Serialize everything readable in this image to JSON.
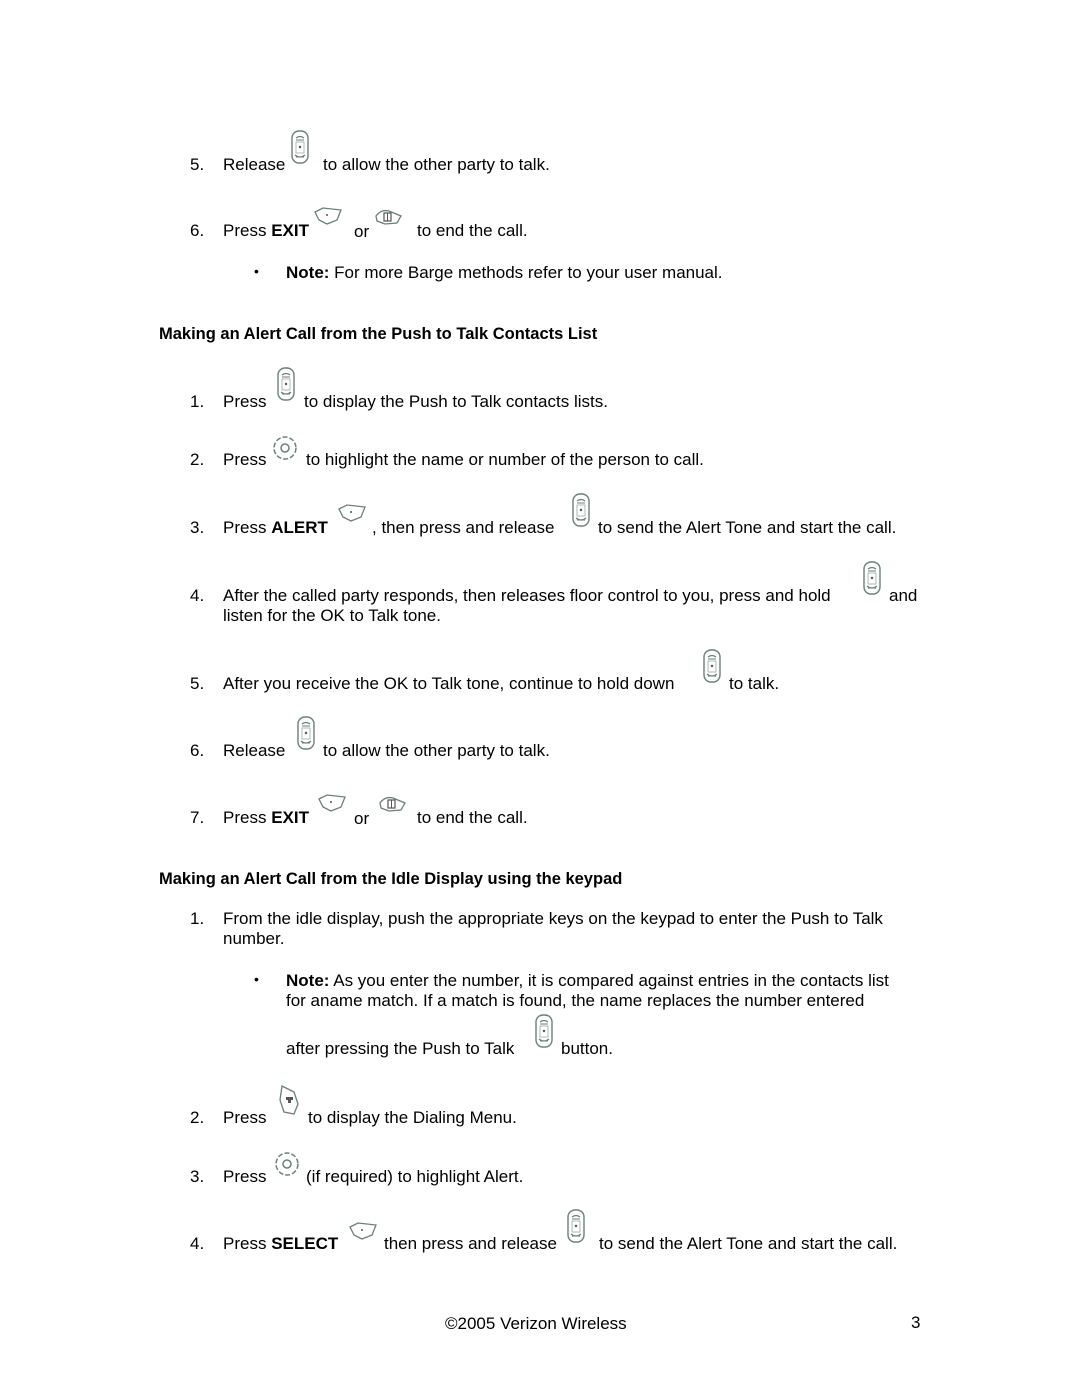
{
  "section1": {
    "steps": [
      {
        "num": "5.",
        "parts": [
          "Release",
          "to allow the other party to talk."
        ],
        "icons": [
          "ptt-button-icon"
        ]
      },
      {
        "num": "6.",
        "pre": "Press ",
        "bold": "EXIT",
        "or": "or",
        "post": "to end the call.",
        "icons": [
          "left-softkey-icon",
          "end-key-icon"
        ]
      }
    ],
    "note": {
      "label": "Note:",
      "text": " For more Barge methods refer to your user manual."
    }
  },
  "section2": {
    "heading": "Making an Alert Call from the Push to Talk Contacts List",
    "steps": [
      {
        "num": "1.",
        "pre": "Press",
        "post": "to display the Push to Talk contacts lists.",
        "icon": "ptt-button-icon"
      },
      {
        "num": "2.",
        "pre": "Press",
        "post": "to highlight the name or number of the person to call.",
        "icon": "nav-key-icon"
      },
      {
        "num": "3.",
        "pre": "Press ",
        "bold": "ALERT",
        "mid": ", then press and release",
        "post": "to send the Alert Tone and start the call.",
        "icons": [
          "left-softkey-icon",
          "ptt-button-icon"
        ]
      },
      {
        "num": "4.",
        "line1": "After the called party responds, then releases floor control to you, press and hold",
        "line1_end": "and",
        "line2": "listen for the OK to Talk tone.",
        "icon": "ptt-button-icon"
      },
      {
        "num": "5.",
        "pre": "After you receive the OK to Talk tone, continue to hold down",
        "post": "to talk.",
        "icon": "ptt-button-icon"
      },
      {
        "num": "6.",
        "pre": "Release",
        "post": "to allow the other party to talk.",
        "icon": "ptt-button-icon"
      },
      {
        "num": "7.",
        "pre": "Press ",
        "bold": "EXIT",
        "or": "or",
        "post": "to end the call.",
        "icons": [
          "left-softkey-icon",
          "end-key-icon"
        ]
      }
    ]
  },
  "section3": {
    "heading": "Making an Alert Call from the Idle Display using the keypad",
    "steps": [
      {
        "num": "1.",
        "line1": "From the idle display, push the appropriate keys on the keypad to enter the Push to Talk",
        "line2": "number."
      },
      {
        "num": "2.",
        "pre": "Press",
        "post": "to display the Dialing Menu.",
        "icon": "right-softkey-menu-icon"
      },
      {
        "num": "3.",
        "pre": "Press",
        "post": "(if required) to highlight Alert.",
        "icon": "nav-key-icon"
      },
      {
        "num": "4.",
        "pre": "Press ",
        "bold": "SELECT",
        "mid": "then press and release",
        "post": "to send the Alert Tone and start the call.",
        "icons": [
          "left-softkey-icon",
          "ptt-button-icon"
        ]
      }
    ],
    "note": {
      "label": "Note:",
      "line1": " As you enter the number, it is compared against entries in the contacts list",
      "line2": "for aname match. If a match is found, the name replaces the number entered",
      "line3_pre": "after pressing the Push to Talk",
      "line3_post": "button."
    }
  },
  "footer": {
    "copyright": "©2005 Verizon Wireless",
    "page_number": "3"
  },
  "colors": {
    "icon_stroke": "#5f7a72",
    "text": "#000000"
  }
}
